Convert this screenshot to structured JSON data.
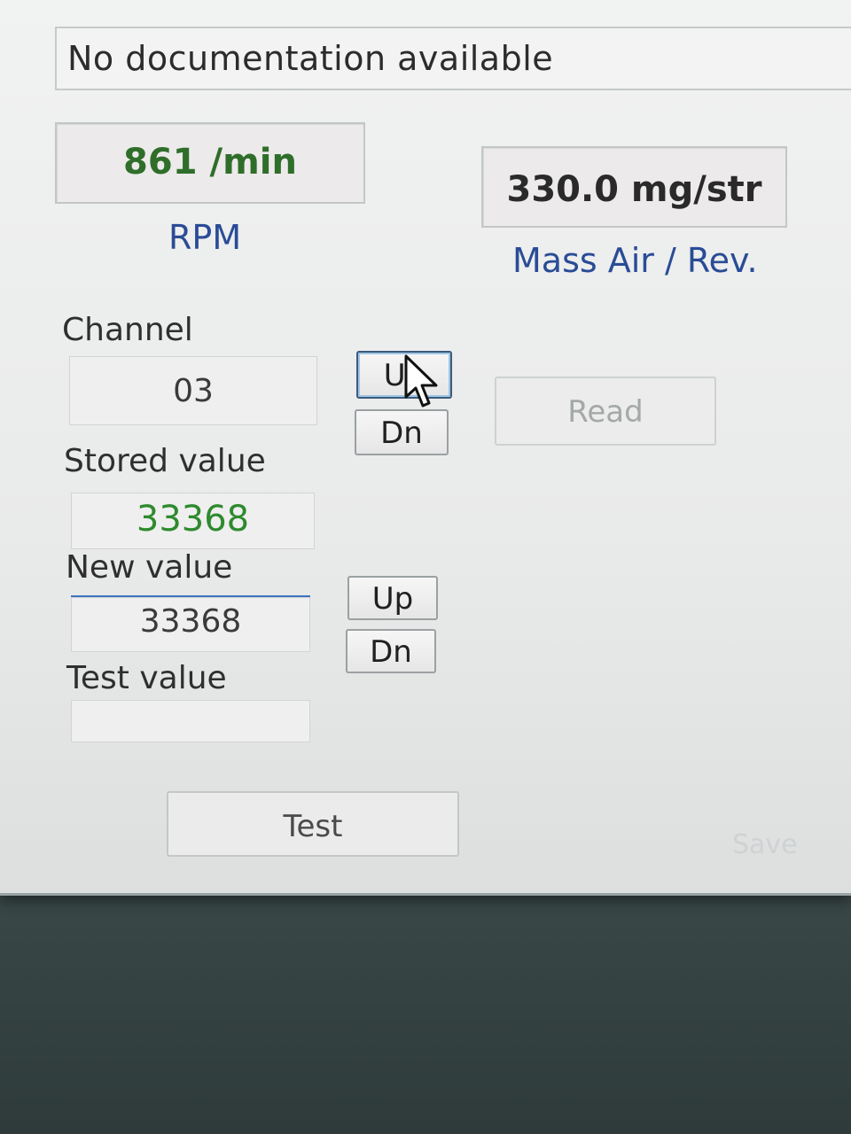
{
  "documentation": {
    "text": "No documentation available"
  },
  "gauges": {
    "rpm": {
      "value": "861 /min",
      "label": "RPM"
    },
    "mass_air": {
      "value": "330.0 mg/str",
      "label": "Mass Air / Rev."
    }
  },
  "channel": {
    "label": "Channel",
    "value": "03",
    "up_label": "Up",
    "down_label": "Dn"
  },
  "read_button": "Read",
  "stored": {
    "label": "Stored value",
    "value": "33368"
  },
  "new_value": {
    "label": "New value",
    "value": "33368",
    "up_label": "Up",
    "down_label": "Dn"
  },
  "test_value": {
    "label": "Test value",
    "value": ""
  },
  "buttons": {
    "test": "Test",
    "save": "Save"
  },
  "colors": {
    "value_green": "#2f6e2a",
    "caption_blue": "#2a4c96",
    "focus_border": "#3b5b7c"
  },
  "icons": {
    "cursor": "mouse-pointer-icon"
  }
}
